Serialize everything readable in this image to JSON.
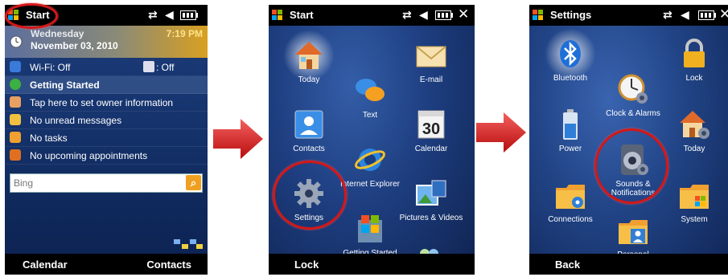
{
  "today_screen": {
    "title": "Start",
    "day": "Wednesday",
    "date": "November 03, 2010",
    "time": "7:19 PM",
    "wifi": "Wi-Fi: Off",
    "bluetooth": ": Off",
    "getting_started": "Getting Started",
    "owner_info": "Tap here to set owner information",
    "messages": "No unread messages",
    "tasks": "No tasks",
    "appointments": "No upcoming appointments",
    "search_placeholder": "Bing",
    "left_softkey": "Calendar",
    "right_softkey": "Contacts"
  },
  "start_screen": {
    "title": "Start",
    "items": [
      {
        "label": "Today",
        "icon": "house-icon"
      },
      {
        "label": "E-mail",
        "icon": "envelope-icon"
      },
      {
        "label": "Text",
        "icon": "chat-bubbles-icon"
      },
      {
        "label": "Contacts",
        "icon": "contact-card-icon"
      },
      {
        "label": "Calendar",
        "icon": "calendar-icon",
        "badge": "30"
      },
      {
        "label": "Internet Explorer",
        "icon": "internet-explorer-icon"
      },
      {
        "label": "Settings",
        "icon": "gear-icon"
      },
      {
        "label": "Pictures & Videos",
        "icon": "pictures-videos-icon"
      },
      {
        "label": "Getting Started",
        "icon": "getting-started-icon"
      }
    ],
    "left_softkey": "Lock"
  },
  "settings_screen": {
    "title": "Settings",
    "items": [
      {
        "label": "Bluetooth",
        "icon": "bluetooth-icon"
      },
      {
        "label": "Lock",
        "icon": "padlock-icon"
      },
      {
        "label": "Clock & Alarms",
        "icon": "clock-icon"
      },
      {
        "label": "Power",
        "icon": "battery-icon"
      },
      {
        "label": "Today",
        "icon": "house-icon"
      },
      {
        "label": "Sounds & Notifications",
        "icon": "speaker-icon"
      },
      {
        "label": "Connections",
        "icon": "connections-folder-icon"
      },
      {
        "label": "System",
        "icon": "system-folder-icon"
      },
      {
        "label": "Personal",
        "icon": "personal-folder-icon"
      }
    ],
    "left_softkey": "Back"
  },
  "colors": {
    "highlight_ring": "#d21818",
    "arrow": "#d81e1e",
    "titlebar": "#000000"
  }
}
